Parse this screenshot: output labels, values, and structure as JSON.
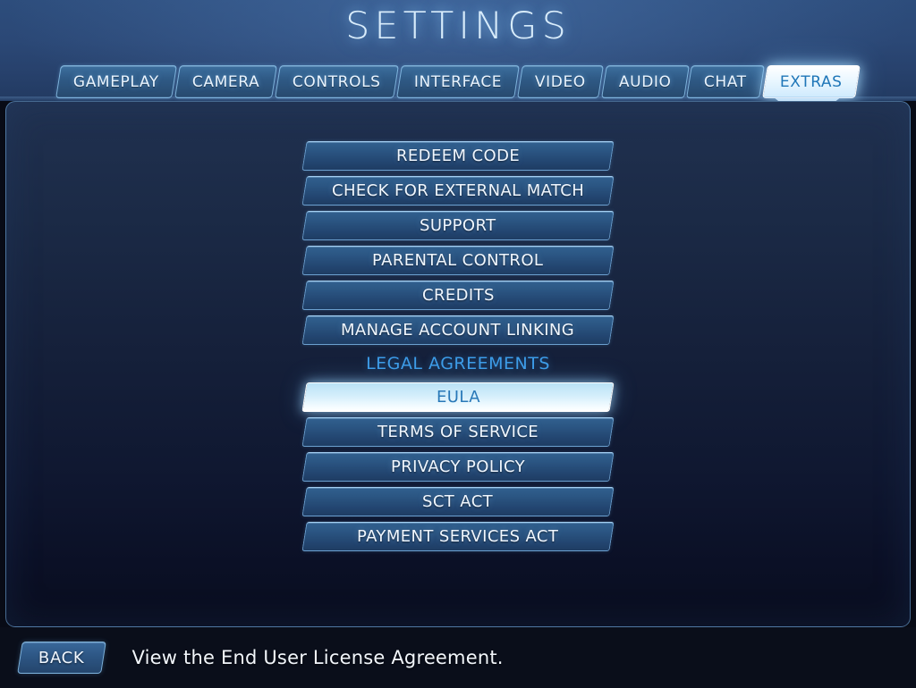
{
  "header": {
    "title": "SETTINGS",
    "tabs": [
      {
        "label": "GAMEPLAY",
        "active": false
      },
      {
        "label": "CAMERA",
        "active": false
      },
      {
        "label": "CONTROLS",
        "active": false
      },
      {
        "label": "INTERFACE",
        "active": false
      },
      {
        "label": "VIDEO",
        "active": false
      },
      {
        "label": "AUDIO",
        "active": false
      },
      {
        "label": "CHAT",
        "active": false
      },
      {
        "label": "EXTRAS",
        "active": true
      }
    ],
    "active_tab": "EXTRAS",
    "active_tab_indicator_icon": "chevron-down-icon"
  },
  "main": {
    "items": [
      {
        "type": "button",
        "label": "REDEEM CODE",
        "selected": false
      },
      {
        "type": "button",
        "label": "CHECK FOR EXTERNAL MATCH",
        "selected": false
      },
      {
        "type": "button",
        "label": "SUPPORT",
        "selected": false
      },
      {
        "type": "button",
        "label": "PARENTAL CONTROL",
        "selected": false
      },
      {
        "type": "button",
        "label": "CREDITS",
        "selected": false
      },
      {
        "type": "button",
        "label": "MANAGE ACCOUNT LINKING",
        "selected": false
      },
      {
        "type": "section",
        "label": "LEGAL AGREEMENTS",
        "selected": false
      },
      {
        "type": "button",
        "label": "EULA",
        "selected": true
      },
      {
        "type": "button",
        "label": "TERMS OF SERVICE",
        "selected": false
      },
      {
        "type": "button",
        "label": "PRIVACY POLICY",
        "selected": false
      },
      {
        "type": "button",
        "label": "SCT ACT",
        "selected": false
      },
      {
        "type": "button",
        "label": "PAYMENT SERVICES ACT",
        "selected": false
      }
    ]
  },
  "footer": {
    "back_label": "BACK",
    "hint": "View the End User License Agreement."
  },
  "colors": {
    "header_blue": "#2d4d7c",
    "panel_top": "#203150",
    "panel_bottom": "#090d1e",
    "accent_cyan": "#3d9ce8",
    "selected_text": "#2878b8",
    "button_blue": "#2a5481",
    "border_blue": "#87beeb",
    "title_glow": "#d8ecfb"
  }
}
